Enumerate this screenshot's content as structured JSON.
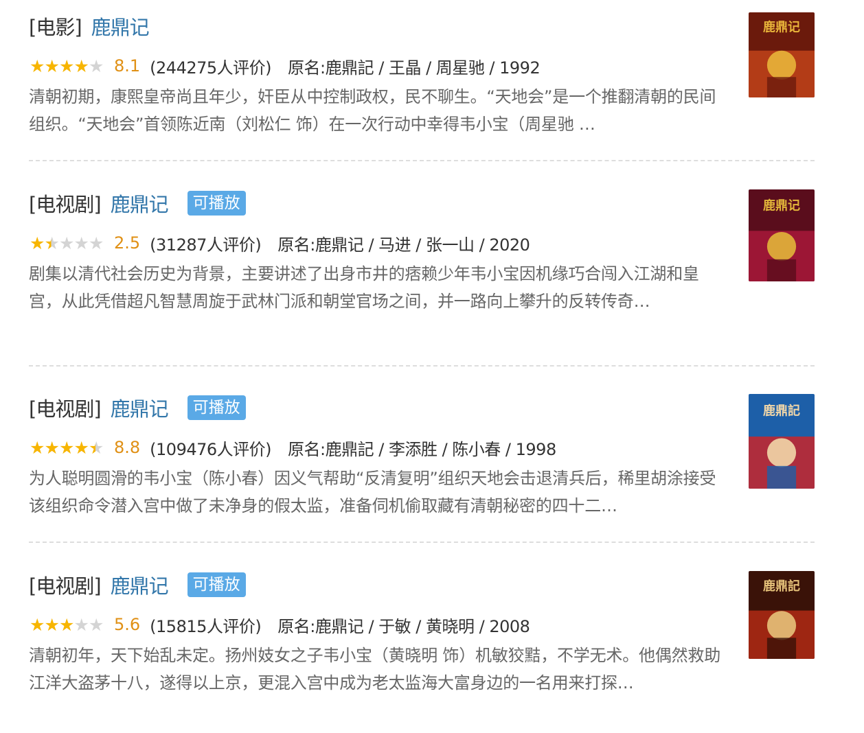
{
  "results": [
    {
      "category": "[电影]",
      "title": "鹿鼎记",
      "playable": false,
      "stars": [
        "full",
        "full",
        "full",
        "full",
        "empty"
      ],
      "rating": 4.0,
      "score": "8.1",
      "votes": "(244275人评价)",
      "meta": "原名:鹿鼎記 / 王晶 / 周星驰 / 1992",
      "description": "清朝初期，康熙皇帝尚且年少，奸臣从中控制政权，民不聊生。“天地会”是一个推翻清朝的民间组织。“天地会”首领陈近南（刘松仁 饰）在一次行动中幸得韦小宝（周星驰 …",
      "poster_label": "鹿鼎记",
      "poster_colors": [
        "#6b1a0c",
        "#c0431a",
        "#e8b43a"
      ]
    },
    {
      "category": "[电视剧]",
      "title": "鹿鼎记",
      "playable": true,
      "playable_label": "可播放",
      "stars": [
        "full",
        "half",
        "empty",
        "empty",
        "empty"
      ],
      "rating": 1.5,
      "score": "2.5",
      "votes": "(31287人评价)",
      "meta": "原名:鹿鼎记 / 马进 / 张一山 / 2020",
      "description": "剧集以清代社会历史为背景，主要讲述了出身市井的痞赖少年韦小宝因机缘巧合闯入江湖和皇宫，从此凭借超凡智慧周旋于武林门派和朝堂官场之间，并一路向上攀升的反转传奇…",
      "poster_label": "鹿鼎记",
      "poster_colors": [
        "#5a0d1c",
        "#a8193a",
        "#e2b53a"
      ]
    },
    {
      "category": "[电视剧]",
      "title": "鹿鼎记",
      "playable": true,
      "playable_label": "可播放",
      "stars": [
        "full",
        "full",
        "full",
        "full",
        "half"
      ],
      "rating": 4.5,
      "score": "8.8",
      "votes": "(109476人评价)",
      "meta": "原名:鹿鼎記 / 李添胜 / 陈小春 / 1998",
      "description": "为人聪明圆滑的韦小宝（陈小春）因义气帮助“反清复明”组织天地会击退清兵后，稀里胡涂接受该组织命令潜入宫中做了未净身的假太监，准备伺机偷取藏有清朝秘密的四十二…",
      "poster_label": "鹿鼎記",
      "poster_colors": [
        "#1d5fa8",
        "#c8242a",
        "#f2d7a8"
      ]
    },
    {
      "category": "[电视剧]",
      "title": "鹿鼎记",
      "playable": true,
      "playable_label": "可播放",
      "stars": [
        "full",
        "full",
        "full",
        "empty",
        "empty"
      ],
      "rating": 3.0,
      "score": "5.6",
      "votes": "(15815人评价)",
      "meta": "原名:鹿鼎记 / 于敏 / 黄晓明 / 2008",
      "description": "清朝初年，天下始乱未定。扬州妓女之子韦小宝（黄晓明 饰）机敏狡黠，不学无术。他偶然救助江洋大盗茅十八，遂得以上京，更混入宫中成为老太监海大富身边的一名用来打探…",
      "poster_label": "鹿鼎記",
      "poster_colors": [
        "#3a1208",
        "#b02a14",
        "#e6c27a"
      ]
    }
  ],
  "star_chars": {
    "full": "★",
    "half": "★",
    "empty": "★"
  },
  "colors": {
    "title_link": "#3377aa",
    "score": "#e09015",
    "badge": "#5aa9e6",
    "star_full": "#f7b500",
    "star_empty": "#d4d4d4"
  }
}
